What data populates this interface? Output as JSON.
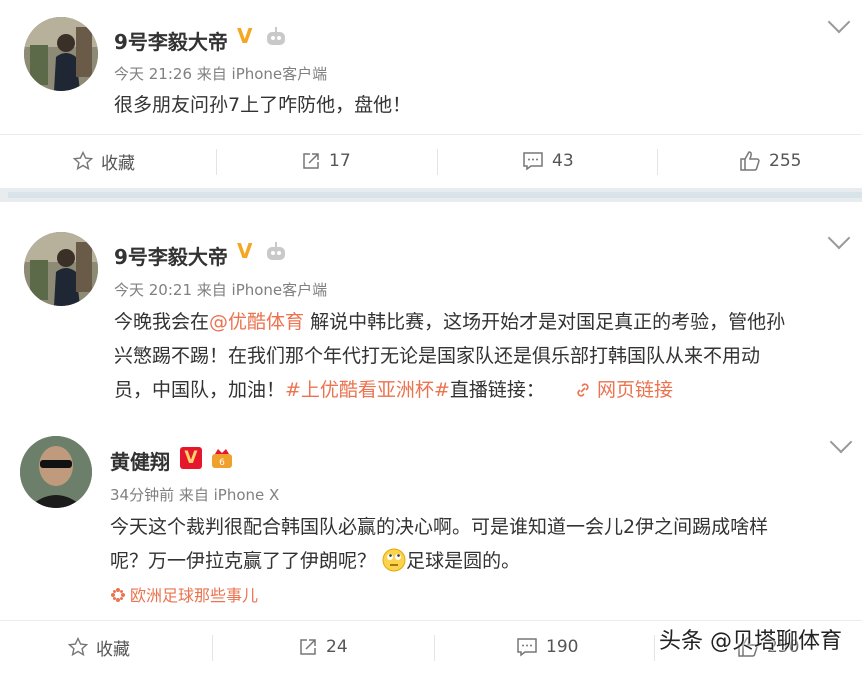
{
  "post1": {
    "author": "9号李毅大帝",
    "meta": "今天 21:26 来自 iPhone客户端",
    "text": "很多朋友问孙7上了咋防他，盘他！",
    "actions": {
      "favorite": "收藏",
      "repost": "17",
      "comment": "43",
      "like": "255"
    }
  },
  "post2": {
    "author": "9号李毅大帝",
    "meta": "今天 20:21 来自 iPhone客户端",
    "line1_a": "今晚我会在",
    "mention": "@优酷体育",
    "line1_b": " 解说中韩比赛，这场开始才是对国足真正的考验，管他孙",
    "line2": "兴慜踢不踢！在我们那个年代打无论是国家队还是俱乐部打韩国队从来不用动",
    "line3_a": "员，中国队，加油！",
    "hashtag": "#上优酷看亚洲杯#",
    "line3_b": "直播链接：",
    "weblink": "网页链接"
  },
  "post3": {
    "author": "黄健翔",
    "meta": "34分钟前 来自 iPhone X",
    "line1": "今天这个裁判很配合韩国队必赢的决心啊。可是谁知道一会儿2伊之间踢成啥样",
    "line2_a": "呢？万一伊拉克赢了了伊朗呢？",
    "line2_b": "足球是圆的。",
    "topic": "欧洲足球那些事儿",
    "actions": {
      "favorite": "收藏",
      "repost": "24",
      "comment": "190",
      "like": "250"
    }
  },
  "watermark": "头条 @贝塔聊体育",
  "colors": {
    "link": "#eb7350",
    "verified": "#f5a623",
    "verified_red": "#e6162d"
  }
}
